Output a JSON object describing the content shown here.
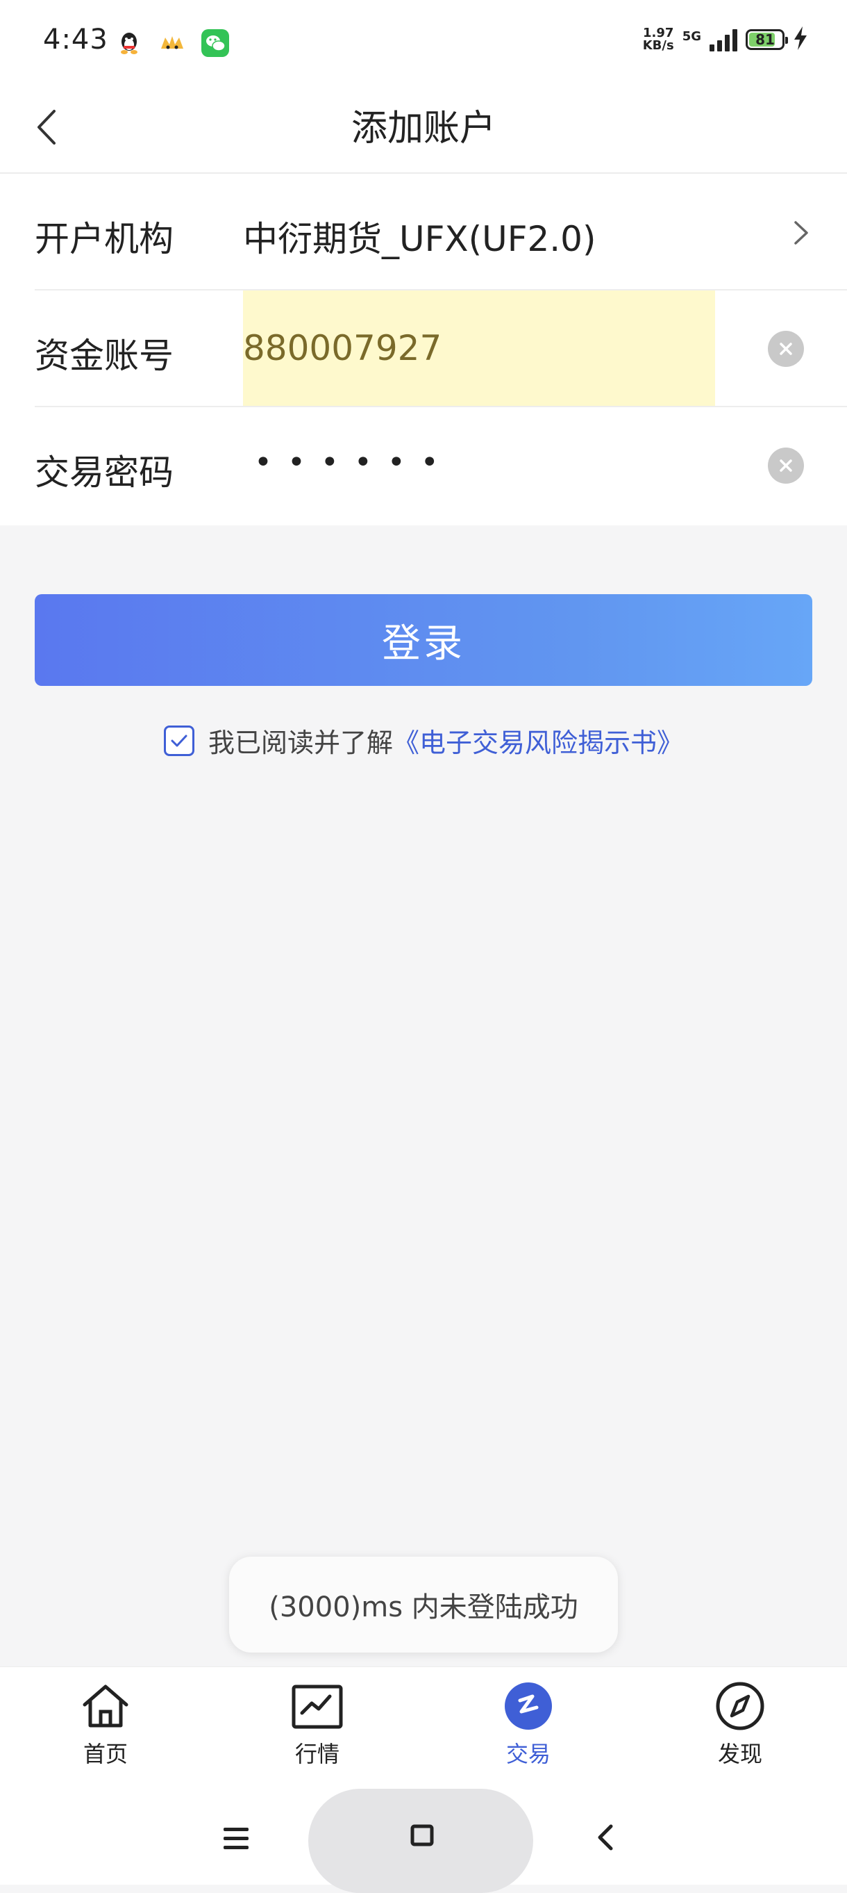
{
  "status_bar": {
    "time": "4:43",
    "net_speed_value": "1.97",
    "net_speed_unit": "KB/s",
    "net_type": "5G",
    "battery_level": 81,
    "battery_label": "81"
  },
  "header": {
    "title": "添加账户"
  },
  "form": {
    "institution": {
      "label": "开户机构",
      "value": "中衍期货_UFX(UF2.0)"
    },
    "account": {
      "label": "资金账号",
      "value": "880007927"
    },
    "password": {
      "label": "交易密码",
      "masked": "••••••"
    }
  },
  "login_button": {
    "label": "登录"
  },
  "agreement": {
    "checked": true,
    "text": "我已阅读并了解",
    "link": "《电子交易风险揭示书》"
  },
  "toast": {
    "text": "(3000)ms 内未登陆成功"
  },
  "tabs": [
    {
      "label": "首页",
      "icon": "home-icon",
      "active": false
    },
    {
      "label": "行情",
      "icon": "chart-icon",
      "active": false
    },
    {
      "label": "交易",
      "icon": "trade-icon",
      "active": true
    },
    {
      "label": "发现",
      "icon": "compass-icon",
      "active": false
    }
  ],
  "colors": {
    "accent": "#3f5fd6",
    "button_gradient_start": "#5a78ef",
    "button_gradient_end": "#67a6f7",
    "highlight": "#fef9cd"
  }
}
